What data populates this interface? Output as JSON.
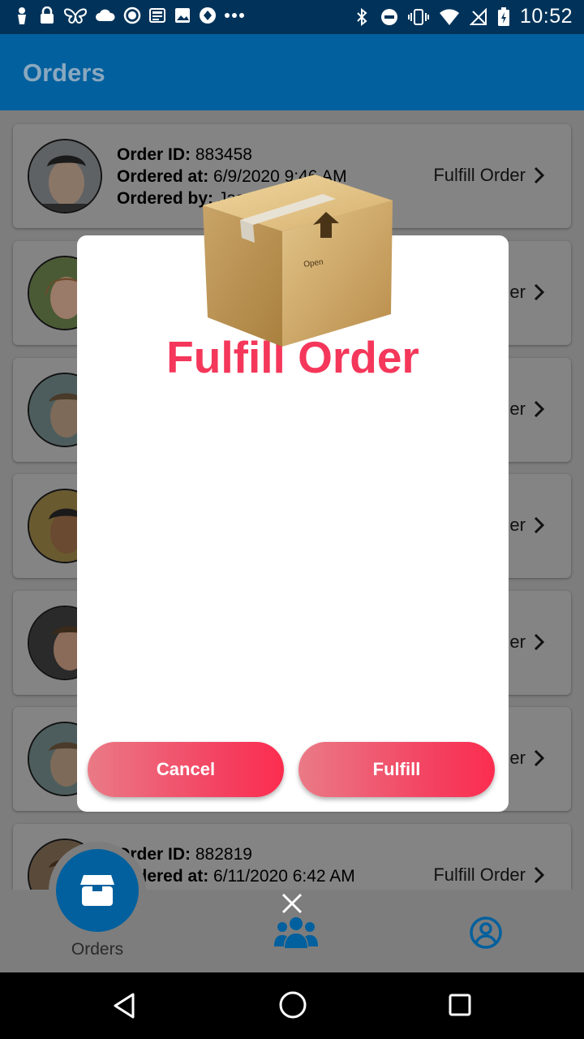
{
  "status_bar": {
    "time": "10:52"
  },
  "app_bar": {
    "title": "Orders"
  },
  "orders": [
    {
      "id_label": "Order ID:",
      "id": " 883458",
      "date_label": "Ordered at:",
      "date": " 6/9/2020 9:46 AM",
      "by_label": "Ordered by:",
      "by": " Jason Singh",
      "action": "Fulfill Order"
    },
    {
      "action": "Fulfill Order"
    },
    {
      "action": "Fulfill Order"
    },
    {
      "action": "Fulfill Order"
    },
    {
      "action": "Fulfill Order"
    },
    {
      "action": "Fulfill Order"
    },
    {
      "id_label": "Order ID:",
      "id": " 882819",
      "date_label": "Ordered at:",
      "date": " 6/11/2020 6:42 AM",
      "action": "Fulfill Order"
    }
  ],
  "modal": {
    "title": "Fulfill Order",
    "box_text": "Open",
    "cancel_label": "Cancel",
    "fulfill_label": "Fulfill"
  },
  "bottom_nav": {
    "orders_label": "Orders"
  },
  "colors": {
    "primary": "#02609e",
    "accent": "#f4375a",
    "status_bar": "#01335a"
  },
  "icons": [
    "box-icon",
    "people-icon",
    "profile-icon",
    "close-icon",
    "chevron-right-icon"
  ]
}
